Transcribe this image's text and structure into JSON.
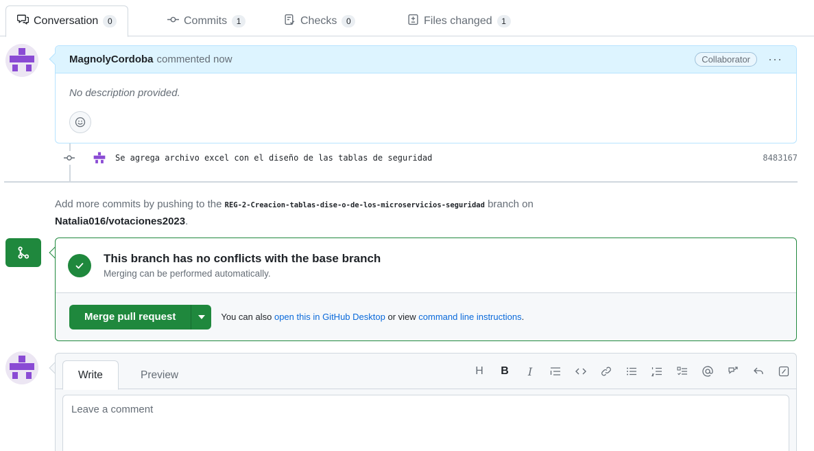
{
  "tabs": [
    {
      "label": "Conversation",
      "count": "0"
    },
    {
      "label": "Commits",
      "count": "1"
    },
    {
      "label": "Checks",
      "count": "0"
    },
    {
      "label": "Files changed",
      "count": "1"
    }
  ],
  "comment": {
    "author": "MagnolyCordoba",
    "action": "commented now",
    "badge": "Collaborator",
    "more": "···",
    "description": "No description provided."
  },
  "commit": {
    "message": "Se agrega archivo excel con el diseño de las tablas de seguridad",
    "sha": "8483167"
  },
  "info": {
    "prefix": "Add more commits by pushing to the",
    "branch": "REG-2-Creacion-tablas-dise-o-de-los-microservicios-seguridad",
    "suffix": "branch on",
    "repo": "Natalia016/votaciones2023",
    "end": "."
  },
  "merge": {
    "title": "This branch has no conflicts with the base branch",
    "subtitle": "Merging can be performed automatically.",
    "button": "Merge pull request",
    "also_text": "You can also",
    "desktop_link": "open this in GitHub Desktop",
    "or_text": "or view",
    "cli_link": "command line instructions",
    "end": "."
  },
  "editor": {
    "write_tab": "Write",
    "preview_tab": "Preview",
    "placeholder": "Leave a comment",
    "tools": [
      "H",
      "B",
      "I"
    ]
  },
  "colors": {
    "green": "#1f883d",
    "blue_link": "#0969da",
    "comment_header": "#ddf4ff",
    "avatar_purple": "#8a4bd4"
  }
}
